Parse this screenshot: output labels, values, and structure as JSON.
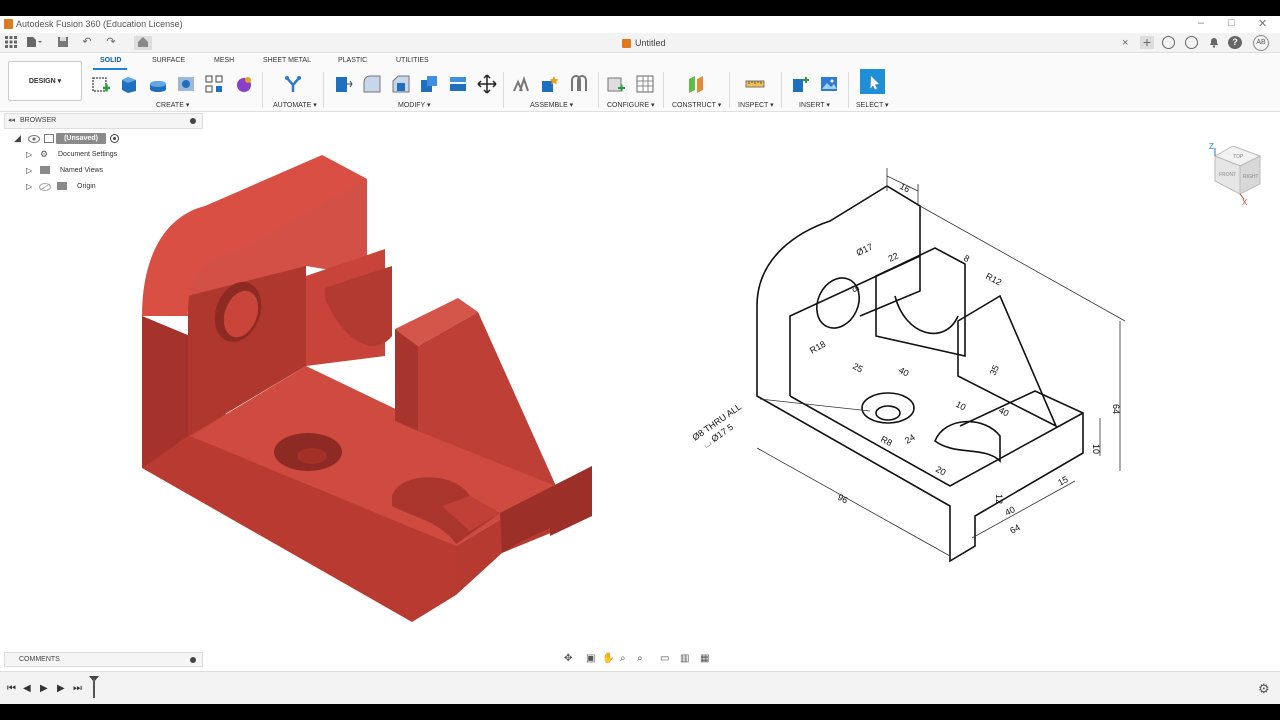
{
  "titlebar": {
    "title": "Autodesk Fusion 360 (Education License)",
    "minimize": "–",
    "maximize": "□",
    "close": "✕"
  },
  "document": {
    "tab_title": "Untitled",
    "close": "×"
  },
  "toolbar": {
    "workspace": "DESIGN ▾",
    "tabs": [
      "SOLID",
      "SURFACE",
      "MESH",
      "SHEET METAL",
      "PLASTIC",
      "UTILITIES"
    ],
    "active_tab": "SOLID",
    "groups": [
      "CREATE ▾",
      "AUTOMATE ▾",
      "MODIFY ▾",
      "ASSEMBLE ▾",
      "CONFIGURE ▾",
      "CONSTRUCT ▾",
      "INSPECT ▾",
      "INSERT ▾",
      "SELECT ▾"
    ]
  },
  "browser": {
    "title": "BROWSER",
    "root": "(Unsaved)",
    "items": [
      "Document Settings",
      "Named Views",
      "Origin"
    ]
  },
  "comments": {
    "title": "COMMENTS"
  },
  "viewcube": {
    "axis_z": "Z",
    "axis_x": "X",
    "faces": [
      "TOP",
      "FRONT",
      "RIGHT"
    ]
  },
  "drawing": {
    "dims": [
      "16",
      "Ø17",
      "22",
      "8",
      "R12",
      "5",
      "R18",
      "25",
      "40",
      "35",
      "10",
      "40",
      "64",
      "10",
      "R8",
      "24",
      "20",
      "15",
      "40",
      "64",
      "96",
      "12"
    ],
    "hole_note_1": "Ø8 THRU ALL",
    "hole_note_2": "⌴ Ø17 5"
  },
  "colors": {
    "model_red": "#c8443a",
    "accent": "#1a85d6",
    "app_orange": "#e07a1f"
  }
}
